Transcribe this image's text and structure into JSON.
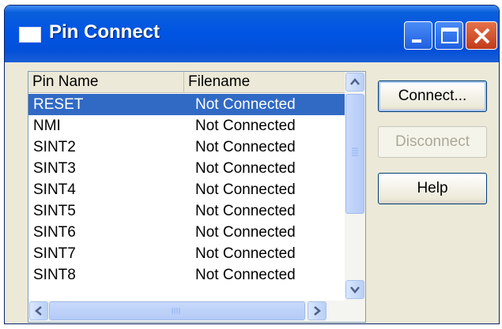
{
  "window": {
    "title": "Pin Connect"
  },
  "list": {
    "columns": [
      "Pin Name",
      "Filename"
    ],
    "rows": [
      {
        "pin": "RESET",
        "file": "Not Connected",
        "selected": true
      },
      {
        "pin": "NMI",
        "file": "Not Connected"
      },
      {
        "pin": "SINT2",
        "file": "Not Connected"
      },
      {
        "pin": "SINT3",
        "file": "Not Connected"
      },
      {
        "pin": "SINT4",
        "file": "Not Connected"
      },
      {
        "pin": "SINT5",
        "file": "Not Connected"
      },
      {
        "pin": "SINT6",
        "file": "Not Connected"
      },
      {
        "pin": "SINT7",
        "file": "Not Connected"
      },
      {
        "pin": "SINT8",
        "file": "Not Connected"
      }
    ]
  },
  "buttons": {
    "connect": "Connect...",
    "disconnect": "Disconnect",
    "help": "Help"
  },
  "colors": {
    "titlebar": "#0054e3",
    "selection": "#316ac5",
    "disabled_text": "#aca899"
  }
}
